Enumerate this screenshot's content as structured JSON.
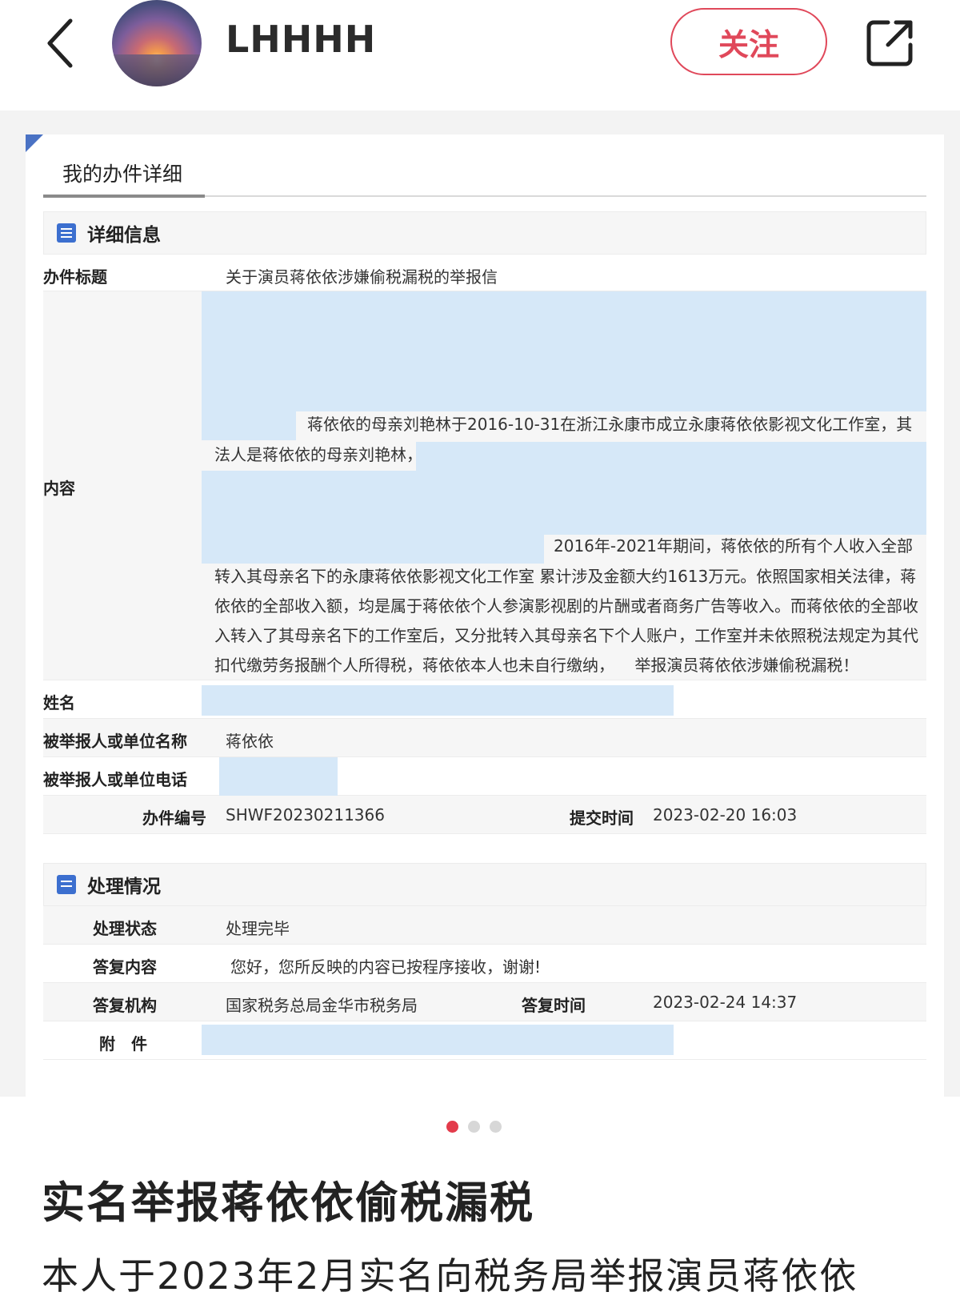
{
  "header": {
    "username": "LHHHH",
    "follow_label": "关注",
    "back_icon": "chevron-left-icon",
    "share_icon": "share-icon"
  },
  "doc": {
    "tab_label": "我的办件详细",
    "section1_title": "详细信息",
    "fields": {
      "title_label": "办件标题",
      "title_value": "关于演员蒋依依涉嫌偷税漏税的举报信",
      "content_label": "内容",
      "content_line1": "蒋依依的母亲刘艳林于2016-10-31在浙江永康市成立永康蒋依依影视文化工作室，其",
      "content_line2": "法人是蒋依依的母亲刘艳林，",
      "content_line3": "2016年-2021年期间，蒋依依的所有个人收入全部",
      "content_line4": "转入其母亲名下的永康蒋依依影视文化工作室 累计涉及金额大约1613万元。依照国家相关法律，蒋",
      "content_line5": "依依的全部收入额，均是属于蒋依依个人参演影视剧的片酬或者商务广告等收入。而蒋依依的全部收",
      "content_line6": "入转入了其母亲名下的工作室后，又分批转入其母亲名下个人账户，工作室并未依照税法规定为其代",
      "content_line7": "扣代缴劳务报酬个人所得税，蒋依依本人也未自行缴纳，    举报演员蒋依依涉嫌偷税漏税！",
      "name_label": "姓名",
      "reported_name_label": "被举报人或单位名称",
      "reported_name_value": "蒋依依",
      "reported_phone_label": "被举报人或单位电话",
      "case_no_label": "办件编号",
      "case_no_value": "SHWF20230211366",
      "submit_time_label": "提交时间",
      "submit_time_value": "2023-02-20 16:03"
    },
    "section2_title": "处理情况",
    "handling": {
      "status_label": "处理状态",
      "status_value": "处理完毕",
      "reply_label": "答复内容",
      "reply_value": "您好，您所反映的内容已按程序接收，谢谢!",
      "org_label": "答复机构",
      "org_value": "国家税务总局金华市税务局",
      "reply_time_label": "答复时间",
      "reply_time_value": "2023-02-24 14:37",
      "attach_label": "附　件"
    }
  },
  "carousel": {
    "count": 3,
    "active": 0
  },
  "post": {
    "title": "实名举报蒋依依偷税漏税",
    "body_preview": "本人于2023年2月实名向税务局举报演员蒋依依"
  },
  "colors": {
    "accent": "#e0485a",
    "mask": "#d6e8f8",
    "icon_blue": "#3c6fcf"
  }
}
